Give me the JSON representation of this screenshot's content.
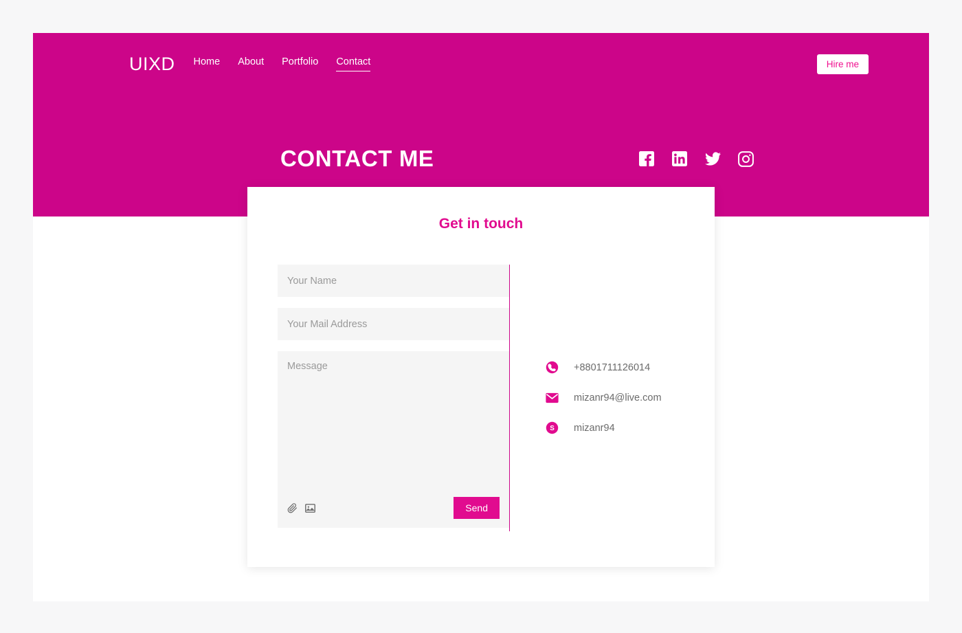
{
  "theme": {
    "banner_pink": "#cc0589",
    "accent_pink": "#e10b8f",
    "hire_text_pink": "#f0108f",
    "page_bg": "#f7f7f8",
    "field_bg": "#f5f5f5",
    "placeholder_gray": "#9a9a9a",
    "body_text_gray": "#6b6b6b"
  },
  "navbar": {
    "brand": "UIXD",
    "links": [
      {
        "label": "Home",
        "active": false
      },
      {
        "label": "About",
        "active": false
      },
      {
        "label": "Portfolio",
        "active": false
      },
      {
        "label": "Contact",
        "active": true
      }
    ],
    "cta_label": "Hire me"
  },
  "hero": {
    "title": "CONTACT ME",
    "socials": [
      {
        "name": "facebook-icon",
        "label": "Facebook"
      },
      {
        "name": "linkedin-icon",
        "label": "LinkedIn"
      },
      {
        "name": "twitter-icon",
        "label": "Twitter"
      },
      {
        "name": "instagram-icon",
        "label": "Instagram"
      }
    ]
  },
  "card": {
    "title": "Get in touch",
    "form": {
      "name_placeholder": "Your Name",
      "name_value": "",
      "email_placeholder": "Your Mail Address",
      "email_value": "",
      "message_placeholder": "Message",
      "message_value": "",
      "attachments": [
        {
          "name": "paperclip-icon",
          "label": "Attach file"
        },
        {
          "name": "image-icon",
          "label": "Attach image"
        }
      ],
      "send_label": "Send"
    },
    "contacts": [
      {
        "icon": "phone-icon",
        "value": "+8801711126014"
      },
      {
        "icon": "mail-icon",
        "value": "mizanr94@live.com"
      },
      {
        "icon": "skype-icon",
        "value": "mizanr94"
      }
    ]
  }
}
